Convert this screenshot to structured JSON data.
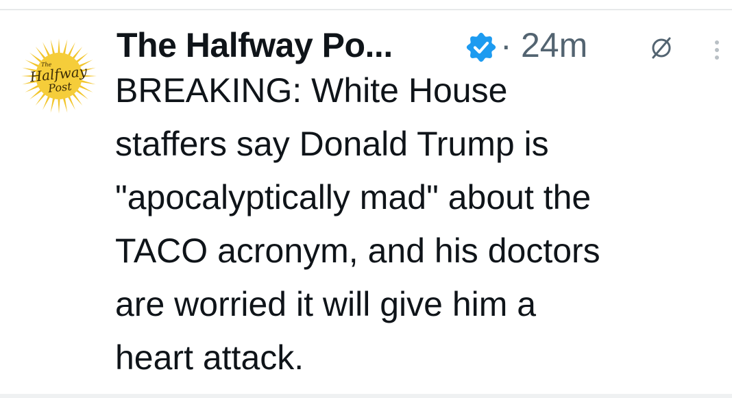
{
  "tweet": {
    "author": {
      "display_name": "The Halfway Po...",
      "avatar_text_top": "The",
      "avatar_text_mid": "Halfway",
      "avatar_text_bottom": "Post",
      "avatar_color": "#f2c52b",
      "verified": true,
      "verified_color": "#1d9bf0"
    },
    "separator": "·",
    "timestamp": "24m",
    "text": "BREAKING: White House staffers say Donald Trump is \"apocalyptically mad\" about the TACO acronym, and his doctors are worried it will give him a heart attack.",
    "lines": [
      "BREAKING: White House",
      "staffers say Donald Trump is",
      "\"apocalyptically mad\" about the",
      "TACO acronym, and his doctors",
      "are worried it will give him a",
      "heart attack."
    ],
    "icons": {
      "verified": "verified-badge-icon",
      "audience": "audience-restricted-icon",
      "more": "more-options-icon"
    }
  }
}
